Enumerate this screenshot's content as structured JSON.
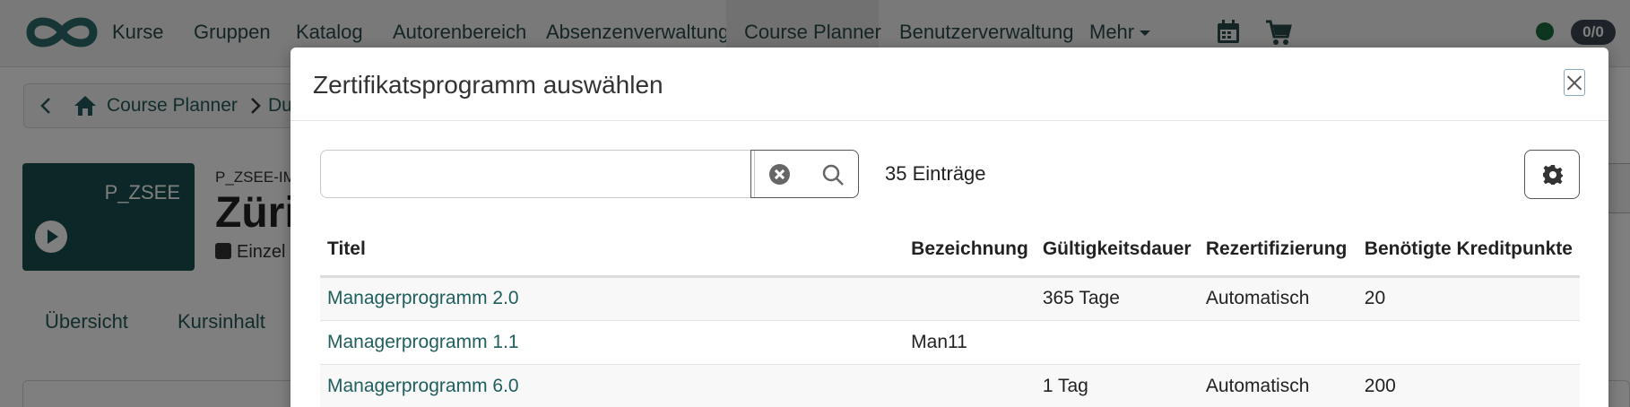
{
  "nav": {
    "items": [
      {
        "label": "Kurse"
      },
      {
        "label": "Gruppen"
      },
      {
        "label": "Katalog"
      },
      {
        "label": "Autorenbereich"
      },
      {
        "label": "Absenzenverwaltung"
      },
      {
        "label": "Course Planner",
        "active": true
      },
      {
        "label": "Benutzerverwaltung"
      },
      {
        "label": "Mehr"
      }
    ],
    "counter": "0/0",
    "icons": [
      "calendar-icon",
      "cart-icon"
    ]
  },
  "breadcrumb": {
    "current": "Course Planner",
    "next": "Du"
  },
  "course": {
    "tile_code": "P_ZSEE",
    "ref": "P_ZSEE-IM",
    "title": "Züri",
    "type": "Einzel"
  },
  "tabs": [
    {
      "label": "Übersicht"
    },
    {
      "label": "Kursinhalt"
    }
  ],
  "modal": {
    "title": "Zertifikatsprogramm auswählen",
    "search": {
      "placeholder": "",
      "value": ""
    },
    "entry_count": "35 Einträge",
    "table": {
      "headers": [
        "Titel",
        "Bezeichnung",
        "Gültigkeitsdauer",
        "Rezertifizierung",
        "Benötigte Kreditpunkte"
      ],
      "rows": [
        {
          "title": "Managerprogramm 2.0",
          "label": "",
          "validity": "365 Tage",
          "recert": "Automatisch",
          "credits": "20"
        },
        {
          "title": "Managerprogramm 1.1",
          "label": "Man11",
          "validity": "",
          "recert": "",
          "credits": ""
        },
        {
          "title": "Managerprogramm 6.0",
          "label": "",
          "validity": "1 Tag",
          "recert": "Automatisch",
          "credits": "200"
        }
      ]
    }
  },
  "colors": {
    "brand": "#1f6a6a",
    "link": "#1f5e5e",
    "status_dot": "#1d6a3a"
  }
}
